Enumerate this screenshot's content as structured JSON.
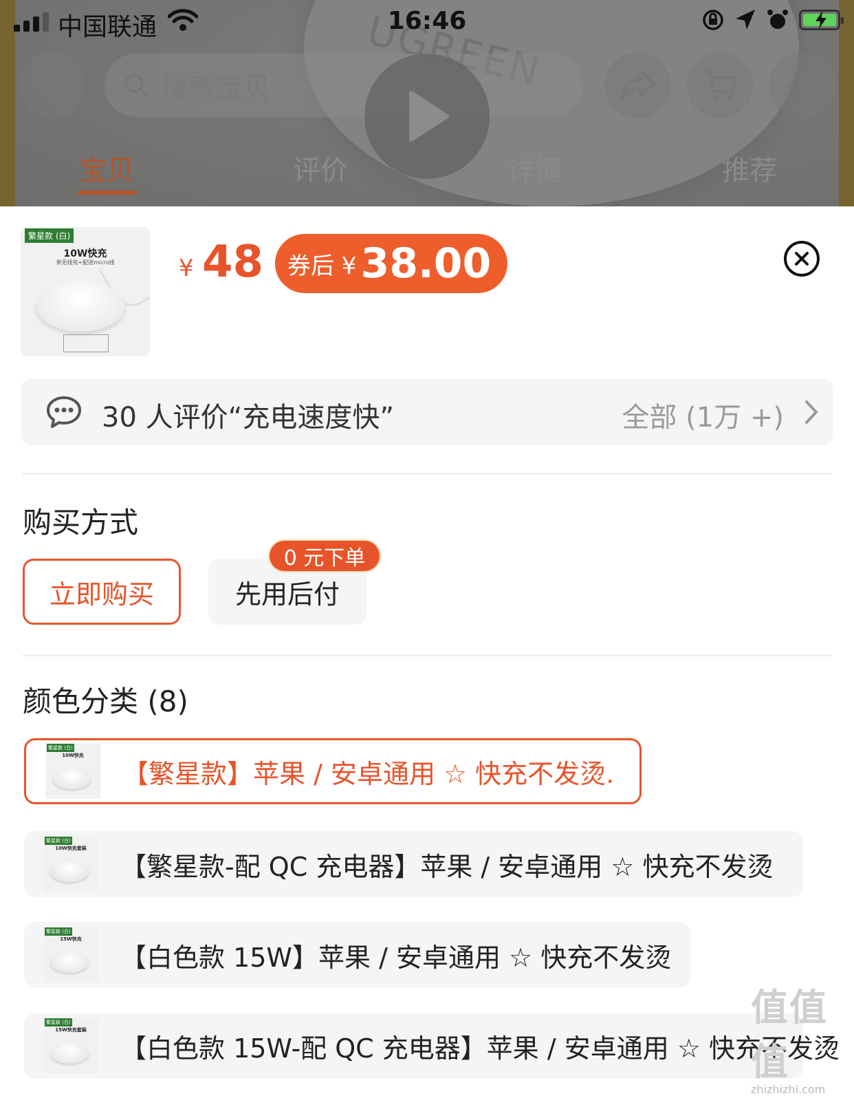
{
  "status_bar": {
    "carrier": "中国联通",
    "time": "16:46"
  },
  "nav": {
    "search_placeholder": "搜索宝贝",
    "tabs": [
      {
        "label": "宝贝",
        "active": true
      },
      {
        "label": "评价",
        "active": false
      },
      {
        "label": "详情",
        "active": false
      },
      {
        "label": "推荐",
        "active": false
      }
    ],
    "background_brand": "UGREEN"
  },
  "sheet": {
    "thumbnail": {
      "tag": "繁星款 (白)",
      "title": "10W快充",
      "subtitle": "单无线充+配送micro线"
    },
    "price_symbol": "¥",
    "price": "48",
    "coupon_label": "券后 ¥",
    "coupon_price": "38.00",
    "review": {
      "text": "30 人评价“充电速度快”",
      "all": "全部 (1万 +)"
    },
    "purchase": {
      "title": "购买方式",
      "options": [
        {
          "label": "立即购买",
          "selected": true
        },
        {
          "label": "先用后付",
          "selected": false
        }
      ],
      "badge": "0 元下单"
    },
    "color": {
      "title": "颜色分类 (8)",
      "variants": [
        {
          "label": "【繁星款】苹果 / 安卓通用 ☆ 快充不发烫.",
          "thumb_tag": "繁星款 (白)",
          "thumb_title": "10W快充",
          "selected": true
        },
        {
          "label": "【繁星款-配 QC 充电器】苹果 / 安卓通用 ☆ 快充不发烫",
          "thumb_tag": "繁星款 (白)",
          "thumb_title": "10W快充套装",
          "selected": false
        },
        {
          "label": "【白色款 15W】苹果 / 安卓通用 ☆ 快充不发烫",
          "thumb_tag": "繁星款 (白)",
          "thumb_title": "15W快充",
          "selected": false
        },
        {
          "label": "【白色款 15W-配 QC 充电器】苹果 / 安卓通用 ☆ 快充不发烫",
          "thumb_tag": "繁星款 (白)",
          "thumb_title": "15W快充套装",
          "selected": false
        }
      ]
    }
  },
  "watermark": {
    "chars": "值值值",
    "url": "zhizhizhi.com"
  },
  "colors": {
    "accent": "#e8542a",
    "coupon_bg": "#ee5e2c",
    "option_bg": "#f5f5f5"
  }
}
